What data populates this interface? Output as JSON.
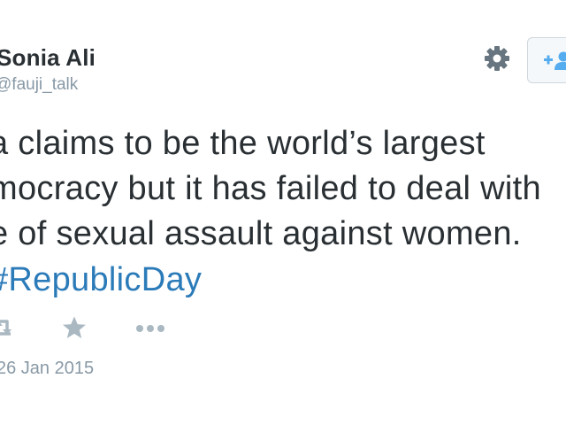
{
  "author": {
    "name": "Sonia Ali",
    "handle": "@fauji_talk"
  },
  "tweet": {
    "lines": [
      "a claims to be the world’s largest",
      "mocracy but it has failed to deal with",
      "e of sexual assault against women.",
      "#RepublicDay"
    ]
  },
  "meta": {
    "date": "26 Jan 2015"
  },
  "icons": {
    "settings": "gear-icon",
    "follow": "follow-user-icon",
    "retweet": "retweet-icon",
    "favorite": "star-icon",
    "more": "more-dots-icon"
  },
  "colors": {
    "text": "#292f33",
    "secondary": "#8899a6",
    "link": "#2b7bb9",
    "icon": "#aab8c2",
    "gear": "#66757f"
  }
}
